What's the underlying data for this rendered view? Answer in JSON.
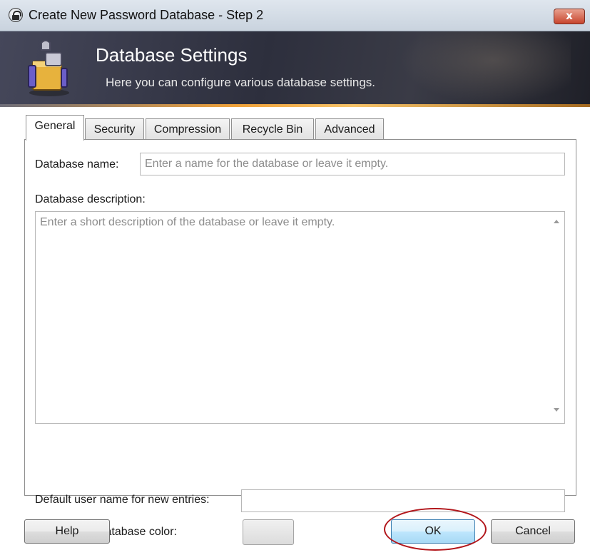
{
  "window": {
    "title": "Create New Password Database - Step 2",
    "close_label": "x"
  },
  "banner": {
    "title": "Database Settings",
    "subtitle": "Here you can configure various database settings."
  },
  "tabs": [
    {
      "label": "General",
      "active": true
    },
    {
      "label": "Security",
      "active": false
    },
    {
      "label": "Compression",
      "active": false
    },
    {
      "label": "Recycle Bin",
      "active": false
    },
    {
      "label": "Advanced",
      "active": false
    }
  ],
  "general": {
    "name_label": "Database name:",
    "name_placeholder": "Enter a name for the database or leave it empty.",
    "name_value": "",
    "description_label": "Database description:",
    "description_placeholder": "Enter a short description of the database or leave it empty.",
    "description_value": "",
    "default_user_label": "Default user name for new entries:",
    "default_user_value": "",
    "custom_color_label": "Custom database color:",
    "custom_color_checked": false
  },
  "buttons": {
    "help": "Help",
    "ok": "OK",
    "cancel": "Cancel"
  },
  "colors": {
    "banner_bg": "#2d2f3d",
    "accent_line": "#f0a23a",
    "highlight_ring": "#b2161b",
    "ok_border": "#3c7fb1"
  }
}
